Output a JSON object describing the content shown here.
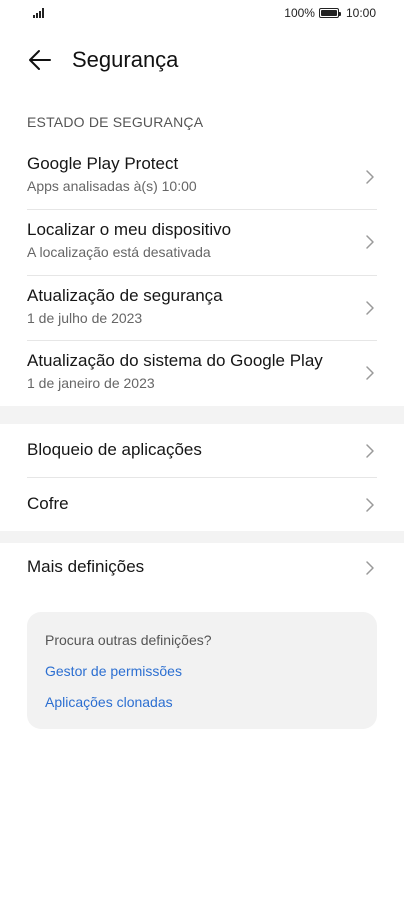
{
  "status_bar": {
    "battery_percent": "100%",
    "time": "10:00",
    "icons": [
      "signal-icon",
      "battery-icon"
    ]
  },
  "header": {
    "back_icon": "arrow-left-icon",
    "title": "Segurança"
  },
  "security_status": {
    "section_title": "ESTADO DE SEGURANÇA",
    "items": [
      {
        "label": "Google Play Protect",
        "sub": "Apps analisadas à(s) 10:00"
      },
      {
        "label": "Localizar o meu dispositivo",
        "sub": "A localização está desativada"
      },
      {
        "label": "Atualização de segurança",
        "sub": "1 de julho de 2023"
      },
      {
        "label": "Atualização do sistema do Google Play",
        "sub": "1 de janeiro de 2023"
      }
    ]
  },
  "apps_group": {
    "items": [
      {
        "label": "Bloqueio de aplicações"
      },
      {
        "label": "Cofre"
      }
    ]
  },
  "more_group": {
    "items": [
      {
        "label": "Mais definições"
      }
    ]
  },
  "suggestion_card": {
    "question": "Procura outras definições?",
    "links": [
      "Gestor de permissões",
      "Aplicações clonadas"
    ]
  },
  "colors": {
    "link": "#2c6fd1",
    "band": "#f3f3f3",
    "card": "#f2f2f2"
  }
}
